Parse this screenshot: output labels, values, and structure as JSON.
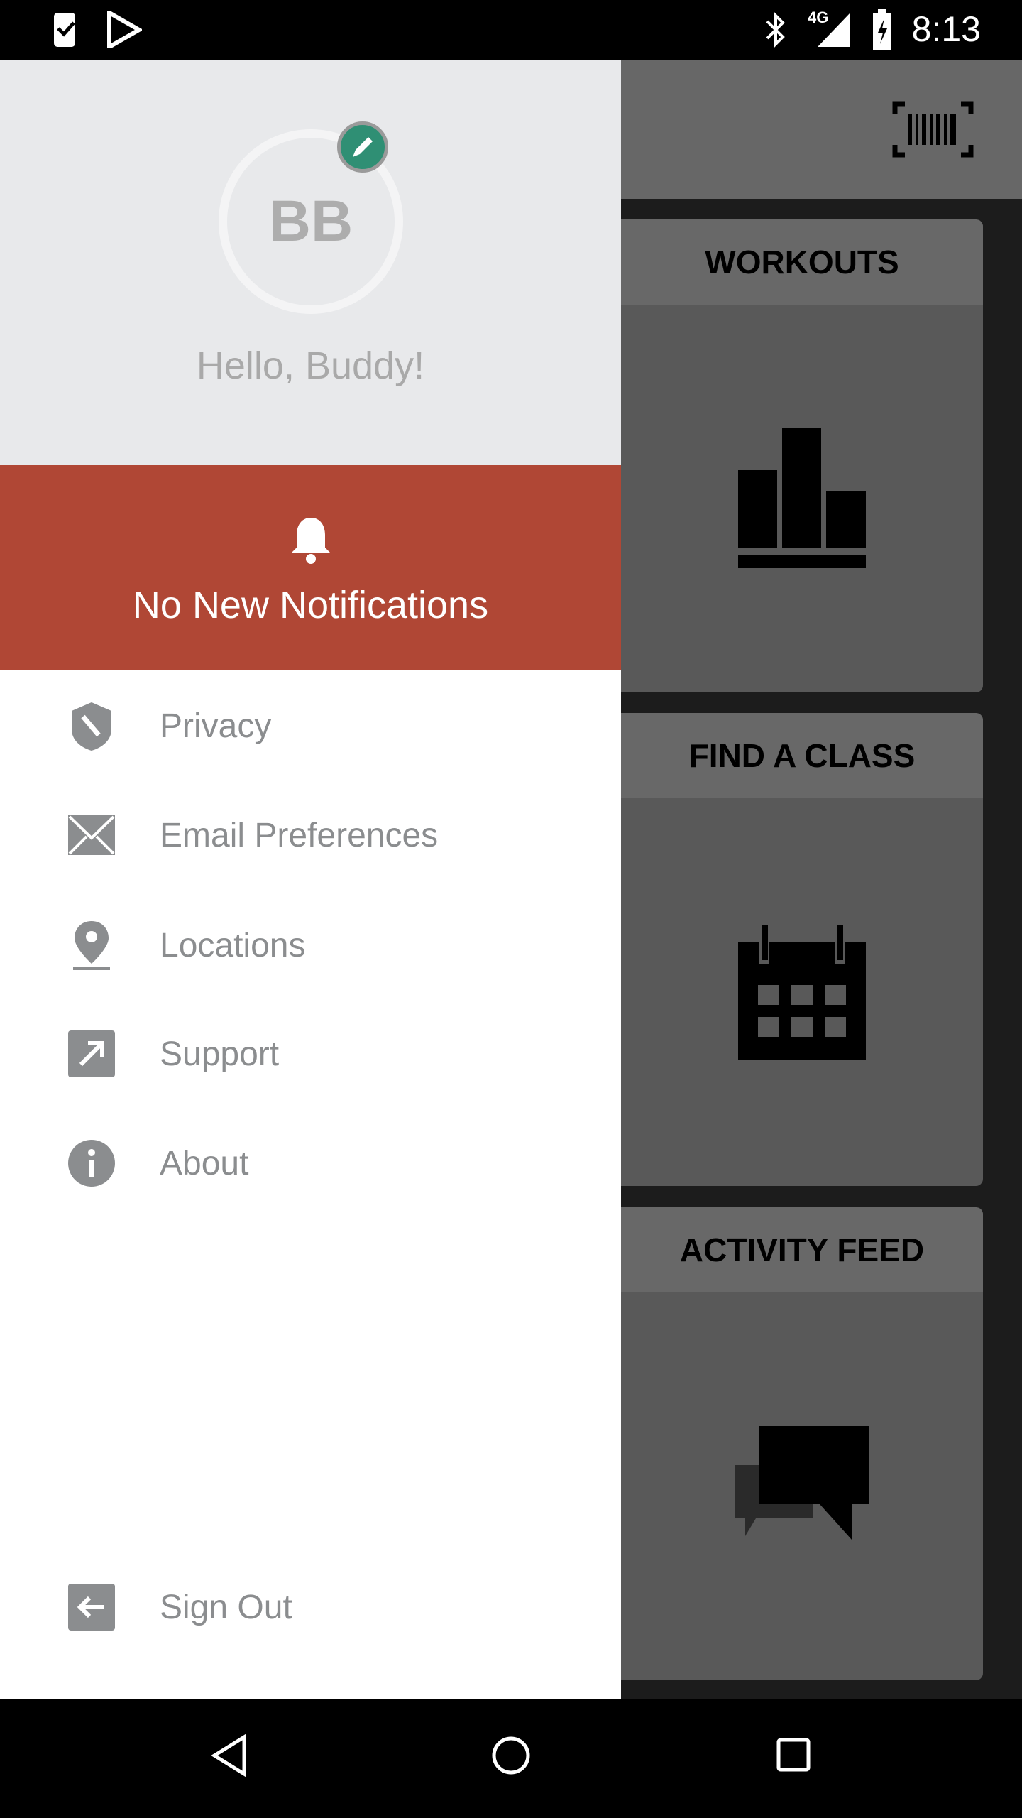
{
  "status_bar": {
    "time": "8:13",
    "network": "4G",
    "icons": [
      "task-icon",
      "play-store-icon",
      "bluetooth-icon",
      "signal-icon",
      "battery-charging-icon"
    ]
  },
  "toolbar": {
    "icon": "barcode-icon"
  },
  "cards": [
    {
      "title": "WORKOUTS",
      "icon": "bar-chart-icon"
    },
    {
      "title": "FIND A CLASS",
      "icon": "calendar-icon"
    },
    {
      "title": "ACTIVITY FEED",
      "icon": "chat-icon"
    }
  ],
  "drawer": {
    "avatar_initials": "BB",
    "greeting": "Hello, Buddy!",
    "notifications": "No New Notifications",
    "items": [
      {
        "label": "Privacy",
        "icon": "shield-icon"
      },
      {
        "label": "Email Preferences",
        "icon": "envelope-icon"
      },
      {
        "label": "Locations",
        "icon": "location-pin-icon"
      },
      {
        "label": "Support",
        "icon": "external-link-icon"
      },
      {
        "label": "About",
        "icon": "info-icon"
      }
    ],
    "sign_out": "Sign Out"
  },
  "colors": {
    "accent": "#b04735",
    "edit": "#2f8f74",
    "menu_text": "#8b8d8f"
  }
}
